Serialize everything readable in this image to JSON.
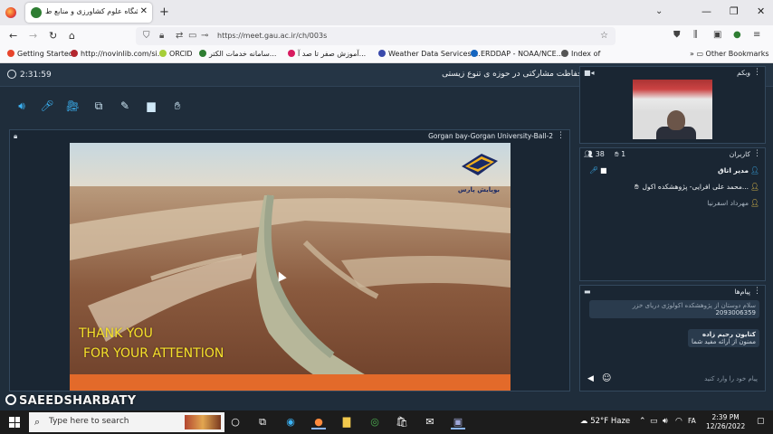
{
  "browser": {
    "tab_title": "دانشگاه علوم کشاورزی و منابع ط",
    "url": "https://meet.gau.ac.ir/ch/003s",
    "bookmarks": [
      {
        "label": "Getting Started",
        "color": "#e8452c"
      },
      {
        "label": "http://novinlib.com/si...",
        "color": "#b3262f"
      },
      {
        "label": "ORCID",
        "color": "#a6ce39"
      },
      {
        "label": "سامانه خدمات الکتر...",
        "color": "#2e7d32"
      },
      {
        "label": "آموزش صفر تا صد آ...",
        "color": "#d81b60"
      },
      {
        "label": "Weather Data Services ...",
        "color": "#3949ab"
      },
      {
        "label": "ERDDAP - NOAA/NCE...",
        "color": "#1565c0"
      },
      {
        "label": "Index of",
        "color": "#555555"
      }
    ],
    "other_bookmarks": "Other Bookmarks"
  },
  "app": {
    "timer": "2:31:59",
    "meeting_title": "دانشگاه علوم کشاورزی و منابع طبیعی گرگان : حفاظت مشارکتی در حوزه ی تنوع زیستی",
    "presentation": {
      "presenter_name": "Gorgan bay-Gorgan University-Ball-2",
      "slide_line1": "THANK YOU",
      "slide_line2": "FOR YOUR ATTENTION",
      "logo_text": "بوپایش پارس"
    },
    "webcam": {
      "title": "وبکم"
    },
    "users": {
      "title": "کاربران",
      "count": "38",
      "raised_hands": "1",
      "list": [
        {
          "name": "مدیر اتاق"
        },
        {
          "name": "محمد علی افرایی- پژوهشکده اکول..."
        },
        {
          "name": "مهرداد اسفرنيا"
        }
      ]
    },
    "chat": {
      "title": "پیام‌ها",
      "messages": [
        {
          "author": "",
          "text": "سلام دوستان از پژوهشکده اکولوژی دریای خزر"
        },
        {
          "author": "",
          "text": "2093006359"
        },
        {
          "author": "کتایون رحیم زاده",
          "text": "ممنون از ارائه مفید شما"
        }
      ],
      "placeholder": "پیام خود را وارد کنید"
    }
  },
  "watermark": "SAEEDSHARBATY",
  "taskbar": {
    "search_placeholder": "Type here to search",
    "weather": "52°F  Haze",
    "lang": "FA",
    "time": "2:39 PM",
    "date": "12/26/2022"
  }
}
